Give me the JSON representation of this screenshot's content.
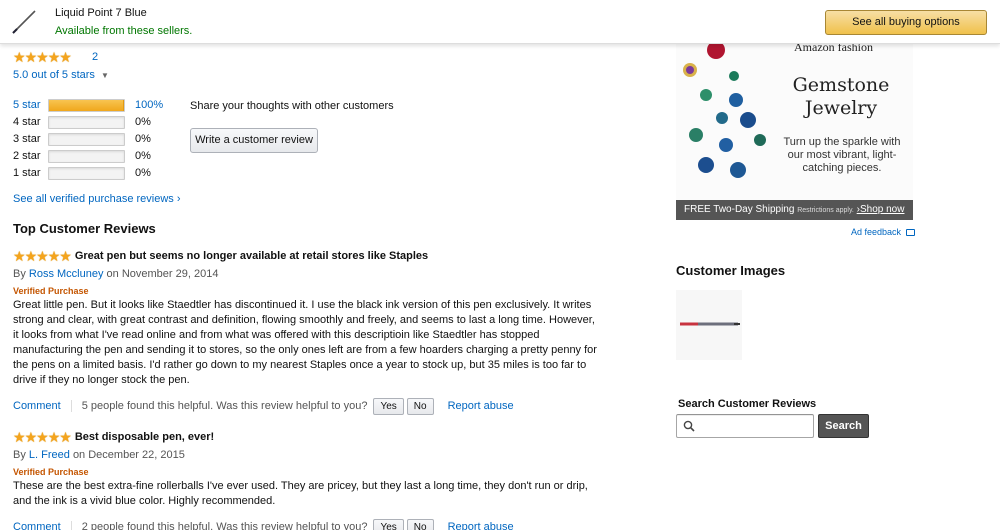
{
  "header": {
    "product_title": "Liquid Point 7 Blue",
    "availability": "Available from these sellers.",
    "buy_button": "See all buying options"
  },
  "rating_summary": {
    "rating": 5,
    "review_count": "2",
    "out_of": "5.0 out of 5 stars",
    "histogram": [
      {
        "label": "5 star",
        "percent": "100%",
        "fill": 1.0
      },
      {
        "label": "4 star",
        "percent": "0%",
        "fill": 0
      },
      {
        "label": "3 star",
        "percent": "0%",
        "fill": 0
      },
      {
        "label": "2 star",
        "percent": "0%",
        "fill": 0
      },
      {
        "label": "1 star",
        "percent": "0%",
        "fill": 0
      }
    ],
    "share_text": "Share your thoughts with other customers",
    "write_review_button": "Write a customer review",
    "see_all_link": "See all verified purchase reviews ›"
  },
  "top_reviews": {
    "title": "Top Customer Reviews",
    "reviews": [
      {
        "stars": 5,
        "title": "Great pen but seems no longer available at retail stores like Staples",
        "by": "By",
        "author": "Ross Mccluney",
        "date": "on November 29, 2014",
        "verified": "Verified Purchase",
        "body": "Great little pen. But it looks like Staedtler has discontinued it. I use the black ink version of this pen exclusively. It writes strong and clear, with great contrast and definition, flowing smoothly and freely, and seems to last a long time. However, it looks from what I've read online and from what was offered with this descriptioin like Staedtler has stopped manufacturing the pen and sending it to stores, so the only ones left are from a few hoarders charging a pretty penny for the pens on a limited basis. I'd rather go down to my nearest Staples once a year to stock up, but 35 miles is too far to drive if they no longer stock the pen.",
        "comment": "Comment",
        "helpful": "5 people found this helpful. Was this review helpful to you?",
        "yes": "Yes",
        "no": "No",
        "report": "Report abuse"
      },
      {
        "stars": 5,
        "title": "Best disposable pen, ever!",
        "by": "By",
        "author": "L. Freed",
        "date": "on December 22, 2015",
        "verified": "Verified Purchase",
        "body": "These are the best extra-fine rollerballs I've ever used. They are pricey, but they last a long time, they don't run or drip, and the ink is a vivid blue color. Highly recommended.",
        "comment": "Comment",
        "helpful": "2 people found this helpful. Was this review helpful to you?",
        "yes": "Yes",
        "no": "No",
        "report": "Report abuse"
      }
    ]
  },
  "ad": {
    "brand": "Amazon fashion",
    "headline_line1": "Gemstone",
    "headline_line2": "Jewelry",
    "subtext": "Turn up the sparkle with our most vibrant, light-catching pieces.",
    "shipping": "FREE Two-Day Shipping",
    "restrictions": "Restrictions apply.",
    "shop_now": "›Shop now",
    "feedback": "Ad feedback"
  },
  "customer_images": {
    "title": "Customer Images"
  },
  "search_reviews": {
    "title": "Search Customer Reviews",
    "placeholder": "",
    "button": "Search"
  }
}
